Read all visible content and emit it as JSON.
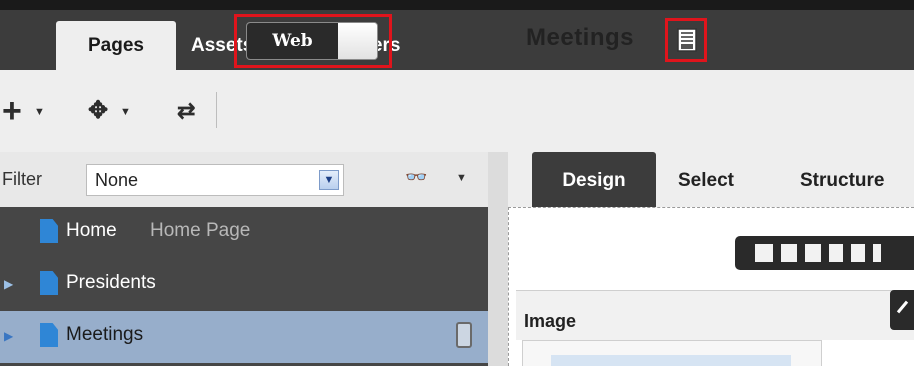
{
  "main_tabs": [
    {
      "label": "Pages",
      "active": true
    },
    {
      "label": "Assets",
      "active": false
    },
    {
      "label": "Members",
      "active": false
    }
  ],
  "toolbar": {
    "view_toggle": {
      "label": "Web",
      "on": true
    },
    "page_title": "Meetings",
    "icons": [
      "add-icon",
      "move-icon",
      "refresh-icon",
      "page-properties-icon"
    ]
  },
  "filter": {
    "label": "Filter",
    "selected": "None",
    "icons": [
      "glasses-icon"
    ]
  },
  "tree": [
    {
      "label": "Home",
      "sublabel": "Home Page",
      "expandable": false,
      "selected": false
    },
    {
      "label": "Presidents",
      "sublabel": "",
      "expandable": true,
      "selected": false
    },
    {
      "label": "Meetings",
      "sublabel": "",
      "expandable": true,
      "selected": true
    }
  ],
  "sub_tabs": [
    {
      "label": "Design",
      "active": true
    },
    {
      "label": "Select",
      "active": false
    },
    {
      "label": "Structure",
      "active": false
    }
  ],
  "canvas": {
    "component_label": "Image"
  },
  "colors": {
    "highlight": "#e0141c",
    "dark_bar": "#3c3c3c",
    "selected_row": "#97aecb",
    "doc_icon": "#2f86d6"
  }
}
